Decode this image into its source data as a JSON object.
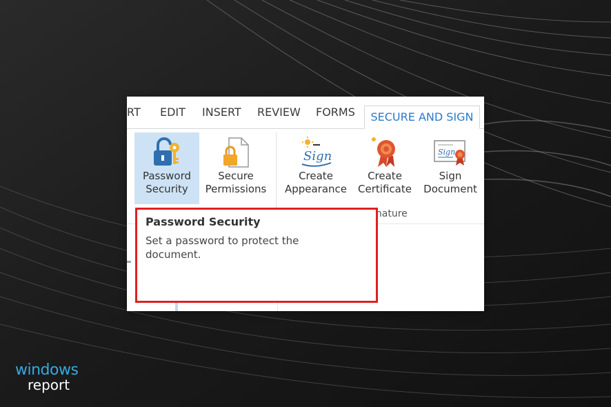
{
  "tabs": [
    "RT",
    "EDIT",
    "INSERT",
    "REVIEW",
    "FORMS"
  ],
  "active_tab": "SECURE AND SIGN",
  "buttons": {
    "password_security": [
      "Password",
      "Security"
    ],
    "secure_permissions": [
      "Secure",
      "Permissions"
    ],
    "create_appearance": [
      "Create",
      "Appearance"
    ],
    "create_certificate": [
      "Create",
      "Certificate"
    ],
    "sign_document": [
      "Sign",
      "Document"
    ]
  },
  "group_label": "gnature",
  "tooltip": {
    "title": "Password Security",
    "body": "Set a password to protect the document."
  },
  "logo": {
    "line1": "windows",
    "line2": "report"
  },
  "colors": {
    "accent": "#2b79c9",
    "highlight": "#e02020",
    "selected": "#cde3f5",
    "logo_blue": "#36a9e1"
  }
}
